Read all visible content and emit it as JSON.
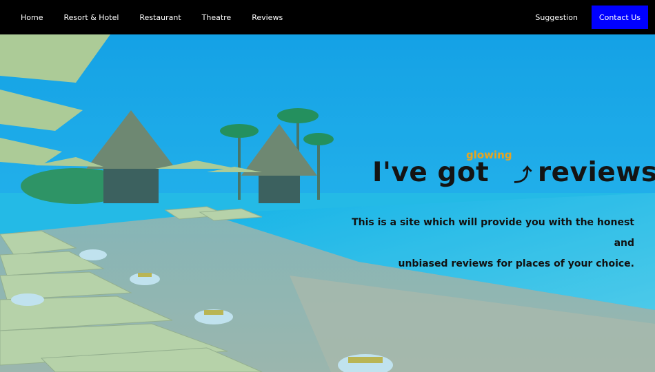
{
  "nav": {
    "links": [
      "Home",
      "Resort & Hotel",
      "Restaurant",
      "Theatre",
      "Reviews"
    ],
    "suggestion": "Suggestion",
    "contact": "Contact Us"
  },
  "hero": {
    "highlight_word": "glowing",
    "headline_left": "I've got",
    "headline_arrow": "⤴",
    "headline_right": "reviews!",
    "tagline_line1": "This is a site which will provide you with the honest and",
    "tagline_line2": "unbiased reviews for places of your choice."
  },
  "colors": {
    "nav_bg": "#000000",
    "contact_bg": "#0000ff",
    "highlight": "#e8a41f",
    "overlay": "#00a8e8"
  }
}
